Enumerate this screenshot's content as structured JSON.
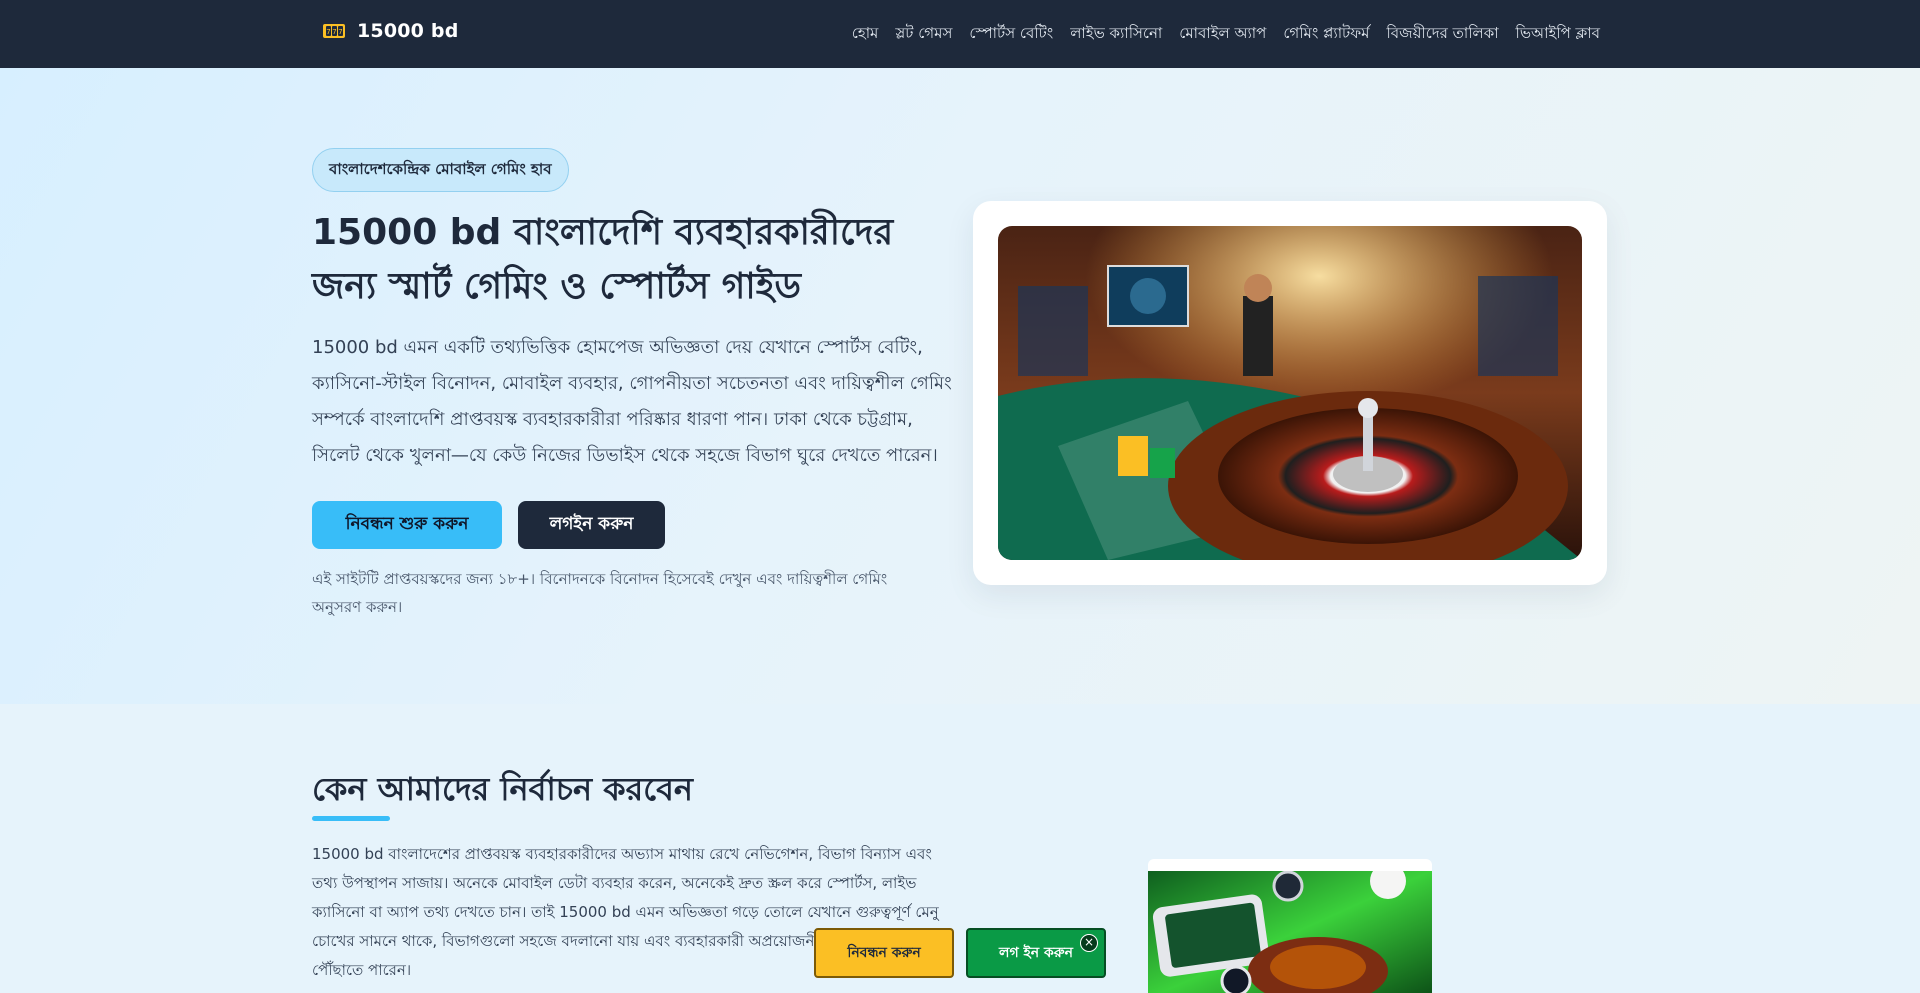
{
  "header": {
    "brand": "15000 bd",
    "logo_icon": "casino-chip-logo-icon",
    "nav": [
      {
        "label": "হোম"
      },
      {
        "label": "স্লট গেমস"
      },
      {
        "label": "স্পোর্টস বেটিং"
      },
      {
        "label": "লাইভ ক্যাসিনো"
      },
      {
        "label": "মোবাইল অ্যাপ"
      },
      {
        "label": "গেমিং প্ল্যাটফর্ম"
      },
      {
        "label": "বিজয়ীদের তালিকা"
      },
      {
        "label": "ভিআইপি ক্লাব"
      }
    ]
  },
  "hero": {
    "badge": "বাংলাদেশকেন্দ্রিক মোবাইল গেমিং হাব",
    "title": "15000 bd বাংলাদেশি ব্যবহারকারীদের জন্য স্মার্ট গেমিং ও স্পোর্টস গাইড",
    "description": "15000 bd এমন একটি তথ্যভিত্তিক হোমপেজ অভিজ্ঞতা দেয় যেখানে স্পোর্টস বেটিং, ক্যাসিনো-স্টাইল বিনোদন, মোবাইল ব্যবহার, গোপনীয়তা সচেতনতা এবং দায়িত্বশীল গেমিং সম্পর্কে বাংলাদেশি প্রাপ্তবয়স্ক ব্যবহারকারীরা পরিষ্কার ধারণা পান। ঢাকা থেকে চট্টগ্রাম, সিলেট থেকে খুলনা—যে কেউ নিজের ডিভাইস থেকে সহজে বিভাগ ঘুরে দেখতে পারেন।",
    "primary_button": "নিবন্ধন শুরু করুন",
    "secondary_button": "লগইন করুন",
    "disclaimer": "এই সাইটটি প্রাপ্তবয়স্কদের জন্য ১৮+। বিনোদনকে বিনোদন হিসেবেই দেখুন এবং দায়িত্বশীল গেমিং অনুসরণ করুন।"
  },
  "why_section": {
    "title": "কেন আমাদের নির্বাচন করবেন",
    "text": "15000 bd বাংলাদেশের প্রাপ্তবয়স্ক ব্যবহারকারীদের অভ্যাস মাথায় রেখে নেভিগেশন, বিভাগ বিন্যাস এবং তথ্য উপস্থাপন সাজায়। অনেকে মোবাইল ডেটা ব্যবহার করেন, অনেকেই দ্রুত স্ক্রল করে স্পোর্টস, লাইভ ক্যাসিনো বা অ্যাপ তথ্য দেখতে চান। তাই 15000 bd এমন অভিজ্ঞতা গড়ে তোলে যেখানে গুরুত্বপূর্ণ মেনু চোখের সামনে থাকে, বিভাগগুলো সহজে বদলানো যায় এবং ব্যবহারকারী অপ্রয়োজনীয় বিভ্রান্তি ছাড়াই নি... পৌঁছাতে পারেন।"
  },
  "floating_bar": {
    "register": "নিবন্ধন করুন",
    "login": "লগ ইন করুন",
    "close": "×"
  },
  "colors": {
    "header_bg": "#1e293b",
    "accent": "#38bdf8",
    "register_float": "#fbbf24",
    "login_float": "#0a9a46"
  }
}
